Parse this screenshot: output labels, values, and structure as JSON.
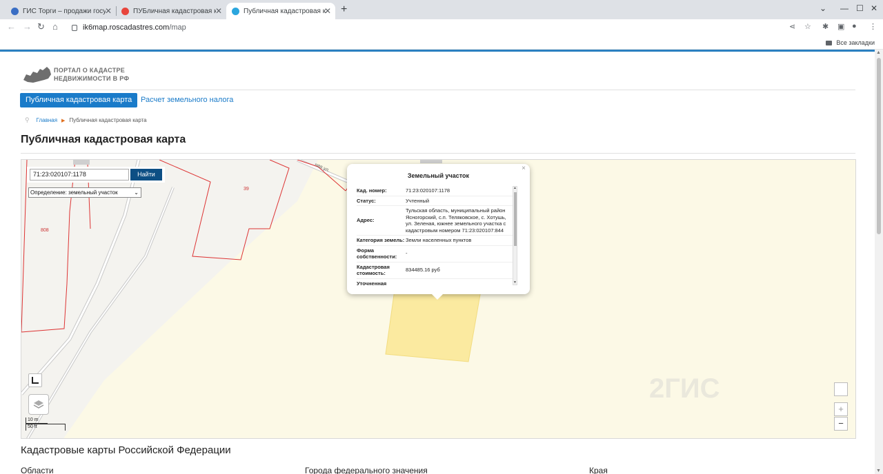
{
  "browser": {
    "tabs": [
      {
        "title": "ГИС Торги – продажи госуд",
        "favicon_color": "#3a6ec4"
      },
      {
        "title": "ПУБличная кадастровая ка",
        "favicon_color": "#e8453c"
      },
      {
        "title": "Публичная кадастровая ка",
        "favicon_color": "#2ba6de"
      }
    ],
    "new_tab_label": "+",
    "url_host": "ik6map.roscadastres.com",
    "url_path": "/map",
    "bookmarks_label": "Все закладки"
  },
  "site": {
    "logo_line1": "ПОРТАЛ О КАДАСТРЕ",
    "logo_line2": "НЕДВИЖИМОСТИ В РФ",
    "menu_active": "Публичная кадастровая карта",
    "menu_link": "Расчет земельного налога",
    "breadcrumb_home": "Главная",
    "breadcrumb_current": "Публичная кадастровая карта",
    "page_title": "Публичная кадастровая карта"
  },
  "map": {
    "search_value": "71:23:020107:1178",
    "search_button": "Найти",
    "definition_label": "Определение:",
    "definition_value": "земельный участок",
    "parcel_labels": [
      "39",
      "808"
    ],
    "street_label": "ная ул.",
    "scale_metric": "10 m",
    "scale_imperial": "50 ft",
    "zoom_in": "+",
    "zoom_out": "−",
    "watermark": "2ГИС"
  },
  "popup": {
    "title": "Земельный участок",
    "close": "×",
    "rows": [
      {
        "key": "Кад. номер:",
        "value": "71:23:020107:1178"
      },
      {
        "key": "Статус:",
        "value": "Учтенный"
      },
      {
        "key": "Адрес:",
        "value": "Тульская область, муниципальный район Ясногорский, с.п. Теляковское, с. Хотушь, ул. Зеленая, южнее земельного участка с кадастровым номером 71:23:020107:844"
      },
      {
        "key": "Категория земель:",
        "value": "Земли населенных пунктов"
      },
      {
        "key": "Форма собственности:",
        "value": "-"
      },
      {
        "key": "Кадастровая стоимость:",
        "value": "834485.16 руб"
      },
      {
        "key": "Уточненная",
        "value": ""
      }
    ]
  },
  "below": {
    "section_title": "Кадастровые карты Российской Федерации",
    "columns": [
      "Области",
      "Города федерального значения",
      "Края"
    ]
  }
}
